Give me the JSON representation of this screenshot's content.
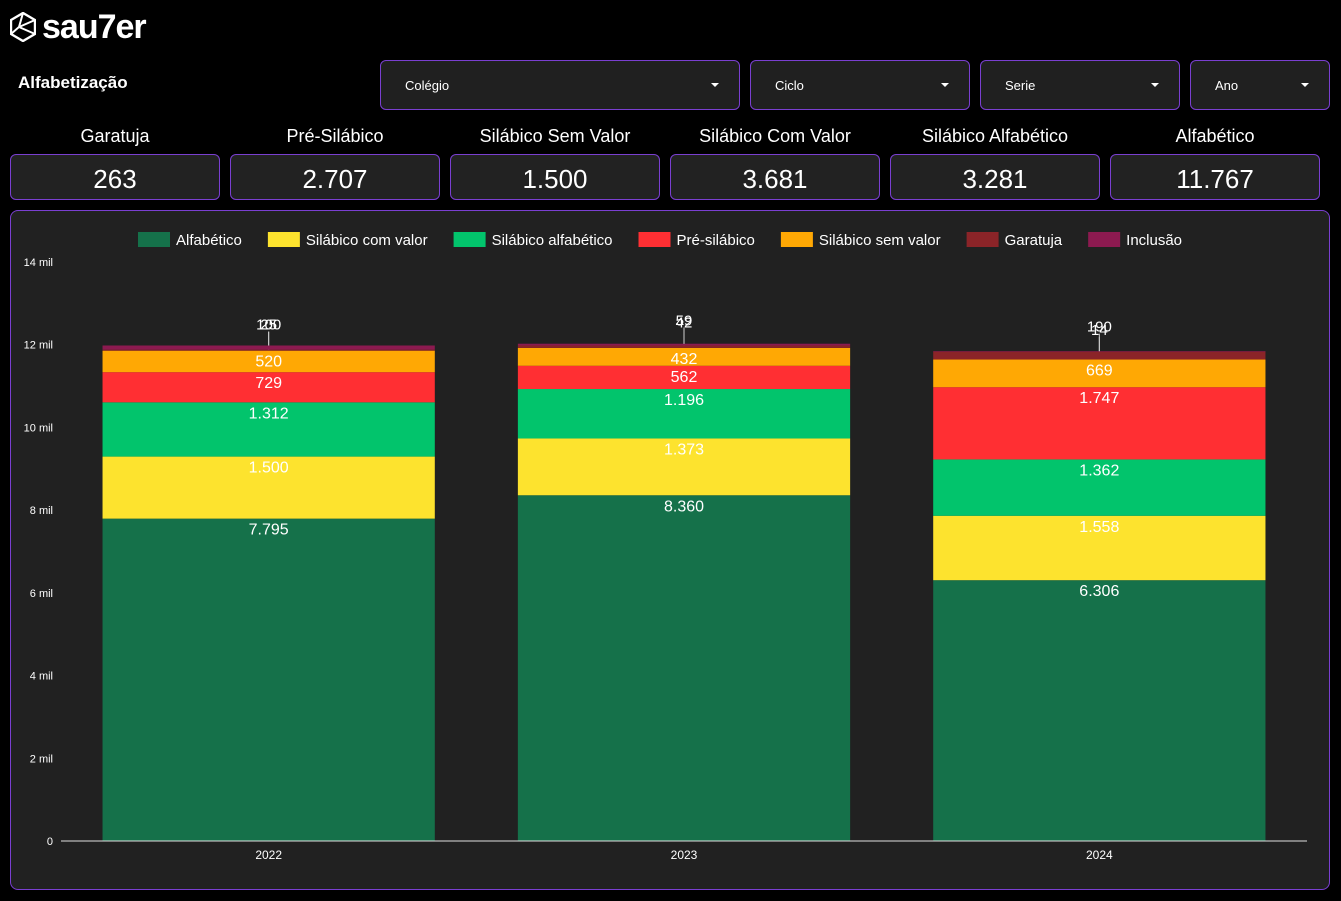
{
  "brand": {
    "name": "sau7er"
  },
  "header": {
    "title": "Alfabetização"
  },
  "filters": [
    {
      "label": "Colégio"
    },
    {
      "label": "Ciclo"
    },
    {
      "label": "Serie"
    },
    {
      "label": "Ano"
    }
  ],
  "kpis": [
    {
      "label": "Garatuja",
      "value": "263"
    },
    {
      "label": "Pré-Silábico",
      "value": "2.707"
    },
    {
      "label": "Silábico Sem Valor",
      "value": "1.500"
    },
    {
      "label": "Silábico Com Valor",
      "value": "3.681"
    },
    {
      "label": "Silábico Alfabético",
      "value": "3.281"
    },
    {
      "label": "Alfabético",
      "value": "11.767"
    }
  ],
  "colors": {
    "accent": "#7a3fd0",
    "panel": "#212121"
  },
  "chart_data": {
    "type": "bar",
    "stacked": true,
    "categories": [
      "2022",
      "2023",
      "2024"
    ],
    "yticks": [
      "0",
      "2 mil",
      "4 mil",
      "6 mil",
      "8 mil",
      "10 mil",
      "12 mil",
      "14 mil"
    ],
    "ylim": [
      0,
      14000
    ],
    "legend_position": "top",
    "series": [
      {
        "name": "Alfabético",
        "color": "#15714a",
        "values": [
          7795,
          8360,
          6306
        ],
        "labels": [
          "7.795",
          "8.360",
          "6.306"
        ]
      },
      {
        "name": "Silábico com valor",
        "color": "#fde32e",
        "values": [
          1500,
          1373,
          1558
        ],
        "labels": [
          "1.500",
          "1.373",
          "1.558"
        ]
      },
      {
        "name": "Silábico alfabético",
        "color": "#02c46c",
        "values": [
          1312,
          1196,
          1362
        ],
        "labels": [
          "1.312",
          "1.196",
          "1.362"
        ]
      },
      {
        "name": "Pré-silábico",
        "color": "#ff2f33",
        "values": [
          729,
          562,
          1747
        ],
        "labels": [
          "729",
          "562",
          "1.747"
        ]
      },
      {
        "name": "Silábico sem valor",
        "color": "#ffa804",
        "values": [
          520,
          432,
          669
        ],
        "labels": [
          "520",
          "432",
          "669"
        ]
      },
      {
        "name": "Garatuja",
        "color": "#8b2428",
        "values": [
          25,
          59,
          190
        ],
        "labels": [
          "25",
          "59",
          "190"
        ]
      },
      {
        "name": "Inclusão",
        "color": "#8c1a50",
        "values": [
          100,
          42,
          14
        ],
        "labels": [
          "100",
          "42",
          "14"
        ]
      }
    ]
  }
}
